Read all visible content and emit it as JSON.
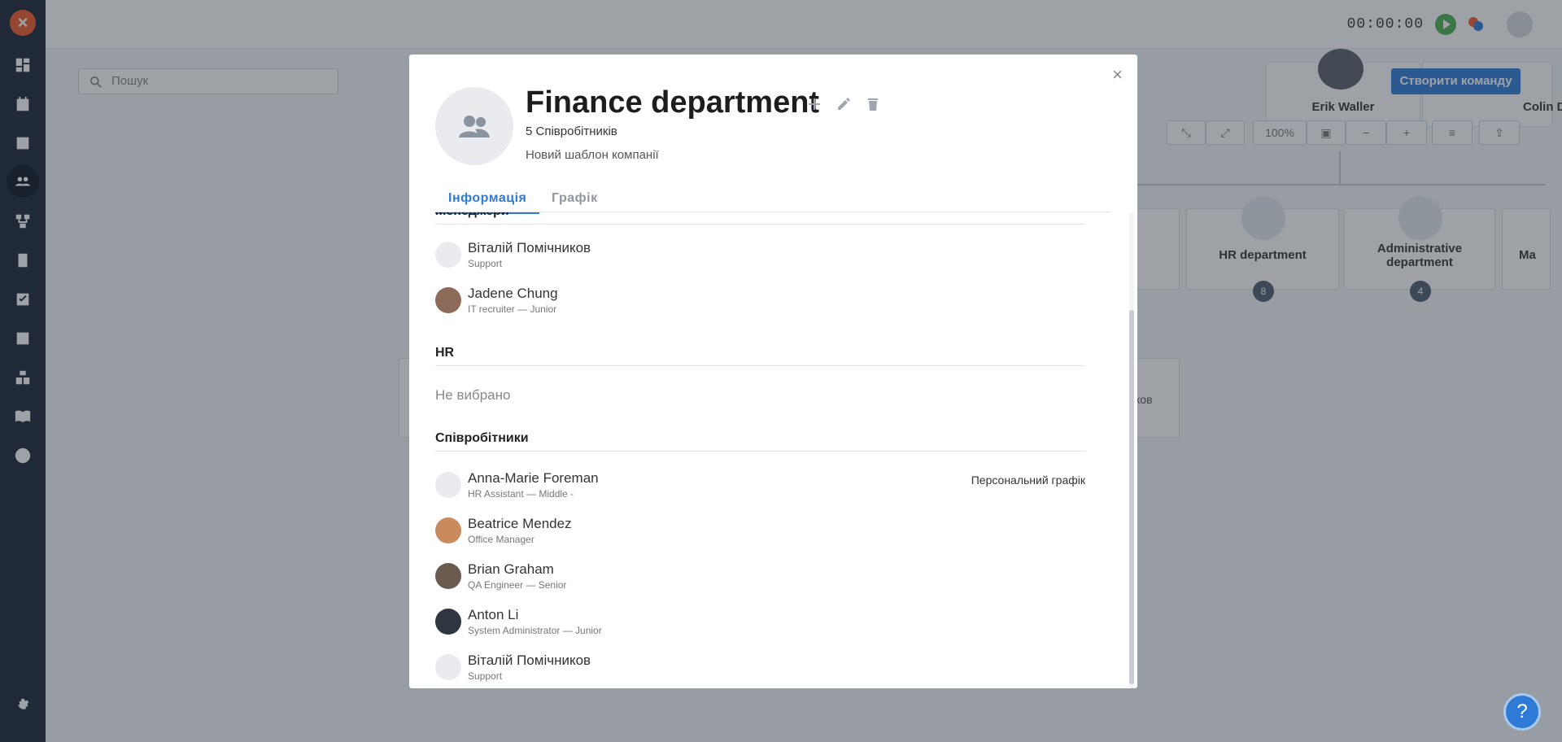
{
  "sidebar": {
    "logo": "×",
    "items": [
      "dashboard-icon",
      "calendar-icon",
      "profile-icon",
      "team-icon",
      "structure-icon",
      "documents-icon",
      "tasks-icon",
      "reports-icon",
      "inventory-icon",
      "knowledge-icon",
      "account-icon"
    ],
    "settings": "settings-icon"
  },
  "topbar": {
    "timer": "00:00:00"
  },
  "background": {
    "search_placeholder": "Пошук",
    "create_team": "Створити команду",
    "zoom": "100%",
    "people": [
      {
        "name": "Erik Waller"
      },
      {
        "name": "Colin Donald"
      }
    ],
    "departments": [
      {
        "name": "HR department",
        "count": "8"
      },
      {
        "name": "Administrative department",
        "count": "4"
      }
    ],
    "partial_text": "ков",
    "partial_dept": "Ma"
  },
  "modal": {
    "close": "×",
    "title": "Finance department",
    "count": "5 Співробітників",
    "template": "Новий шаблон компанії",
    "tabs": {
      "info": "Інформація",
      "schedule": "Графік"
    },
    "managers": {
      "heading": "Менеджери",
      "list": [
        {
          "name": "Віталій Помічников",
          "role": "Support"
        },
        {
          "name": "Jadene Chung",
          "role": "IT recruiter — Junior"
        }
      ]
    },
    "hr": {
      "heading": "HR",
      "empty": "Не вибрано"
    },
    "employees": {
      "heading": "Співробітники",
      "list": [
        {
          "name": "Anna-Marie Foreman",
          "role": "HR Assistant — Middle -",
          "tag": "Персональний графік"
        },
        {
          "name": "Beatrice Mendez",
          "role": "Office Manager"
        },
        {
          "name": "Brian Graham",
          "role": "QA Engineer — Senior"
        },
        {
          "name": "Anton Li",
          "role": "System Administrator — Junior"
        },
        {
          "name": "Віталій Помічников",
          "role": "Support"
        }
      ]
    }
  },
  "help": "?"
}
